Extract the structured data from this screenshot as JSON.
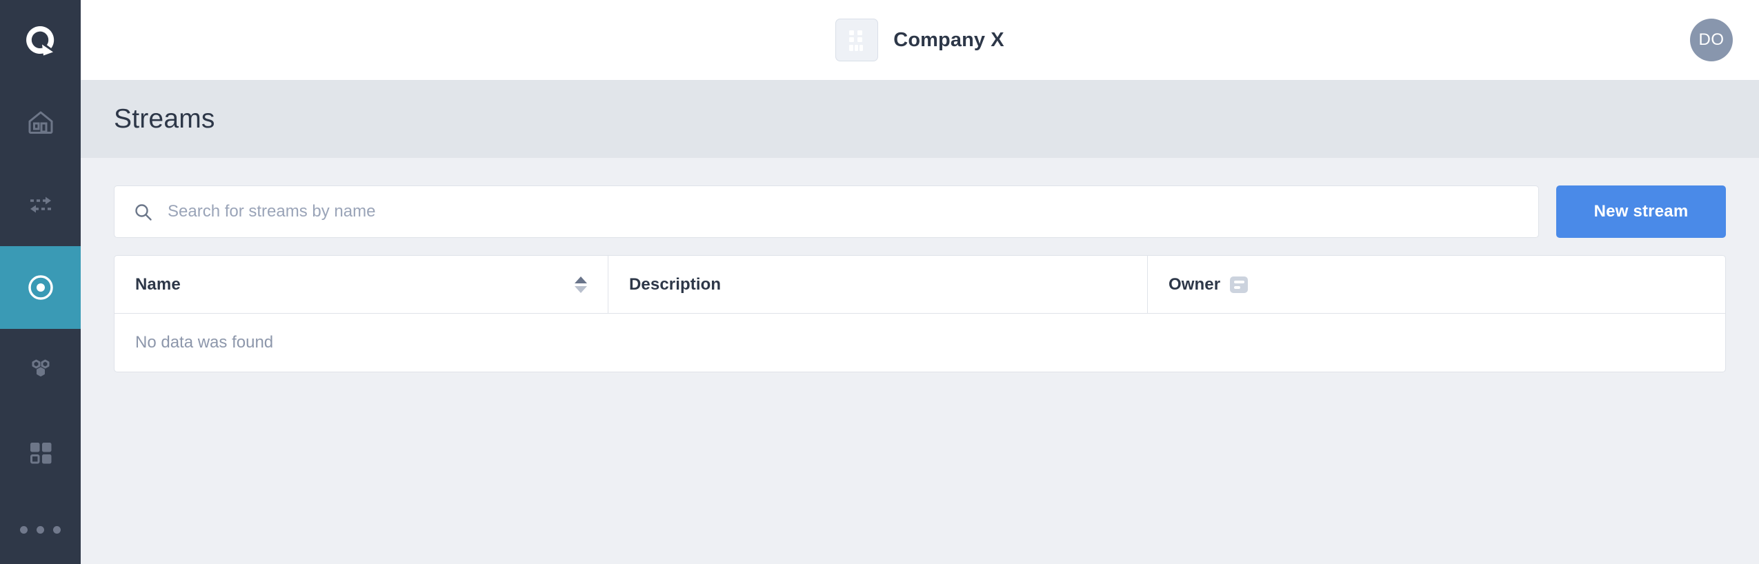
{
  "theme": {
    "sidebar_bg": "#2f3848",
    "sidebar_active_bg": "#3a9ab5",
    "accent_blue": "#4a8ae8",
    "banner_bg": "#e1e5ea",
    "page_bg": "#eef0f4",
    "avatar_bg": "#8896ad",
    "text_dark": "#2d3748",
    "text_muted": "#8d97ab"
  },
  "sidebar": {
    "logo_name": "quix-logo",
    "items": [
      {
        "name": "sidebar-item-home",
        "icon": "home-icon",
        "active": false
      },
      {
        "name": "sidebar-item-pipeline",
        "icon": "data-flow-icon",
        "active": false
      },
      {
        "name": "sidebar-item-streams",
        "icon": "circle-dot-icon",
        "active": true
      },
      {
        "name": "sidebar-item-topics",
        "icon": "nodes-icon",
        "active": false
      },
      {
        "name": "sidebar-item-dashboards",
        "icon": "grid-icon",
        "active": false
      }
    ],
    "more": {
      "name": "sidebar-more-button",
      "icon": "ellipsis-icon"
    }
  },
  "topbar": {
    "org_icon": "building-icon",
    "org_name": "Company X",
    "avatar_initials": "DO"
  },
  "page": {
    "title": "Streams"
  },
  "toolbar": {
    "search_icon": "search-icon",
    "search_value": "",
    "search_placeholder": "Search for streams by name",
    "new_stream_label": "New stream"
  },
  "table": {
    "columns": [
      {
        "label": "Name",
        "sortable": true,
        "sort": "asc",
        "filter_icon": false
      },
      {
        "label": "Description",
        "sortable": false,
        "sort": "none",
        "filter_icon": false
      },
      {
        "label": "Owner",
        "sortable": false,
        "sort": "none",
        "filter_icon": true
      }
    ],
    "rows": [],
    "empty_message": "No data was found"
  }
}
